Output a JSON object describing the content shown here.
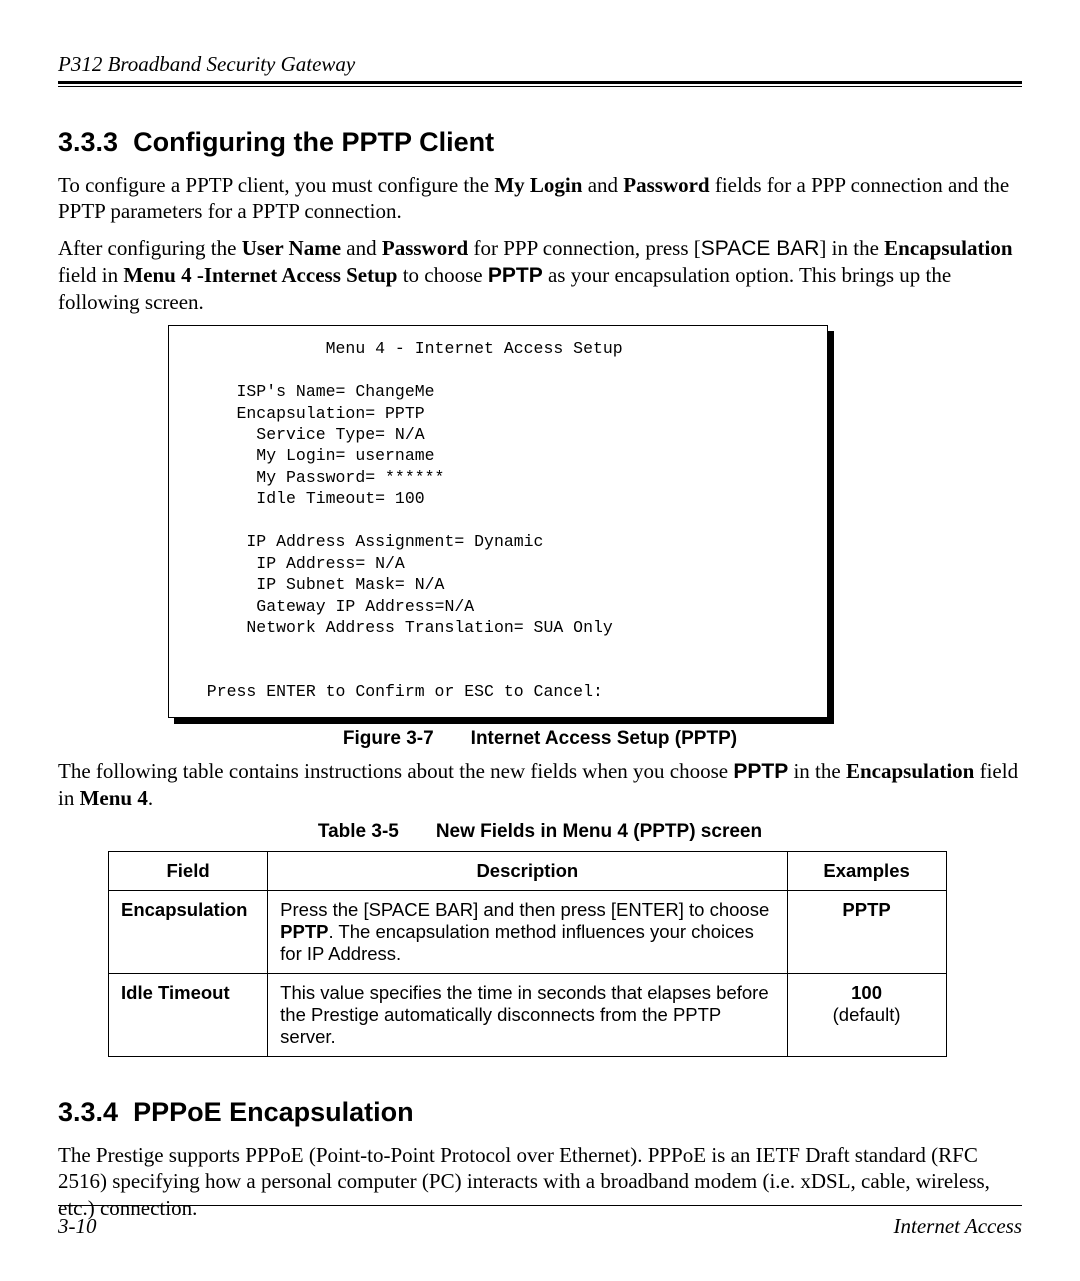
{
  "header": {
    "running_title": "P312  Broadband Security Gateway"
  },
  "section1": {
    "number": "3.3.3",
    "title": "Configuring the PPTP Client",
    "para1_pre": "To configure a PPTP client, you must configure the ",
    "para1_b1": "My Login",
    "para1_mid1": " and ",
    "para1_b2": "Password",
    "para1_post": " fields for a PPP connection and the PPTP parameters for a PPTP connection.",
    "para2_pre": "After configuring the ",
    "para2_b1": "User Name",
    "para2_mid1": " and ",
    "para2_b2": "Password",
    "para2_mid2": " for PPP connection, press [",
    "para2_key": "SPACE BAR",
    "para2_mid3": "] in the ",
    "para2_b3": "Encapsulation",
    "para2_mid4": " field in ",
    "para2_b4": "Menu 4 -Internet Access Setup",
    "para2_mid5": " to choose ",
    "para2_b5": "PPTP",
    "para2_post": " as your encapsulation option. This brings up the following screen."
  },
  "figure": {
    "title_line": "              Menu 4 - Internet Access Setup",
    "isp_line": "     ISP's Name= ChangeMe",
    "encap_line": "     Encapsulation= PPTP",
    "service_line": "       Service Type= N/A",
    "login_line": "       My Login= username",
    "password_line": "       My Password= ******",
    "idle_line": "       Idle Timeout= 100",
    "ipassign_line": "      IP Address Assignment= Dynamic",
    "ipaddr_line": "       IP Address= N/A",
    "subnet_line": "       IP Subnet Mask= N/A",
    "gateway_line": "       Gateway IP Address=N/A",
    "nat_line": "      Network Address Translation= SUA Only",
    "confirm_line": "  Press ENTER to Confirm or ESC to Cancel:",
    "caption_label": "Figure 3-7",
    "caption_title": "Internet Access Setup (PPTP)"
  },
  "after_figure": {
    "pre": "The following table contains instructions about the new fields when you choose ",
    "b1": "PPTP",
    "mid1": " in the ",
    "b2": "Encapsulation",
    "mid2": " field in ",
    "b3": "Menu 4",
    "post": "."
  },
  "table": {
    "caption_label": "Table 3-5",
    "caption_title": "New Fields in Menu 4 (PPTP) screen",
    "head": {
      "c1": "Field",
      "c2": "Description",
      "c3": "Examples"
    },
    "rows": [
      {
        "field": "Encapsulation",
        "desc_pre": "Press the [SPACE BAR] and then press [ENTER] to choose ",
        "desc_b": "PPTP",
        "desc_post": ". The encapsulation method influences your choices for IP Address.",
        "ex1": "PPTP",
        "ex2": ""
      },
      {
        "field": "Idle Timeout",
        "desc_pre": "This value specifies the time in seconds that elapses before the Prestige automatically disconnects from the PPTP server.",
        "desc_b": "",
        "desc_post": "",
        "ex1": "100",
        "ex2": "(default)"
      }
    ]
  },
  "section2": {
    "number": "3.3.4",
    "title": "PPPoE Encapsulation",
    "para": "The Prestige supports PPPoE (Point-to-Point Protocol over Ethernet). PPPoE is an IETF Draft standard (RFC 2516) specifying how a personal computer (PC) interacts with a broadband modem (i.e. xDSL, cable, wireless, etc.) connection."
  },
  "footer": {
    "page": "3-10",
    "section": "Internet Access"
  }
}
